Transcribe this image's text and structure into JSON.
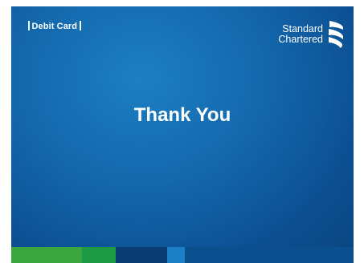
{
  "badge": {
    "label": "Debit Card"
  },
  "logo": {
    "line1": "Standard",
    "line2": "Chartered",
    "icon": "sc-swoosh-icon"
  },
  "main": {
    "title": "Thank You"
  },
  "colors": {
    "slide_bg": "#1468ad",
    "stripe": [
      "#3aa640",
      "#1e9946",
      "#0a3e72",
      "#1a7fc4",
      "#0c4f8e"
    ]
  }
}
